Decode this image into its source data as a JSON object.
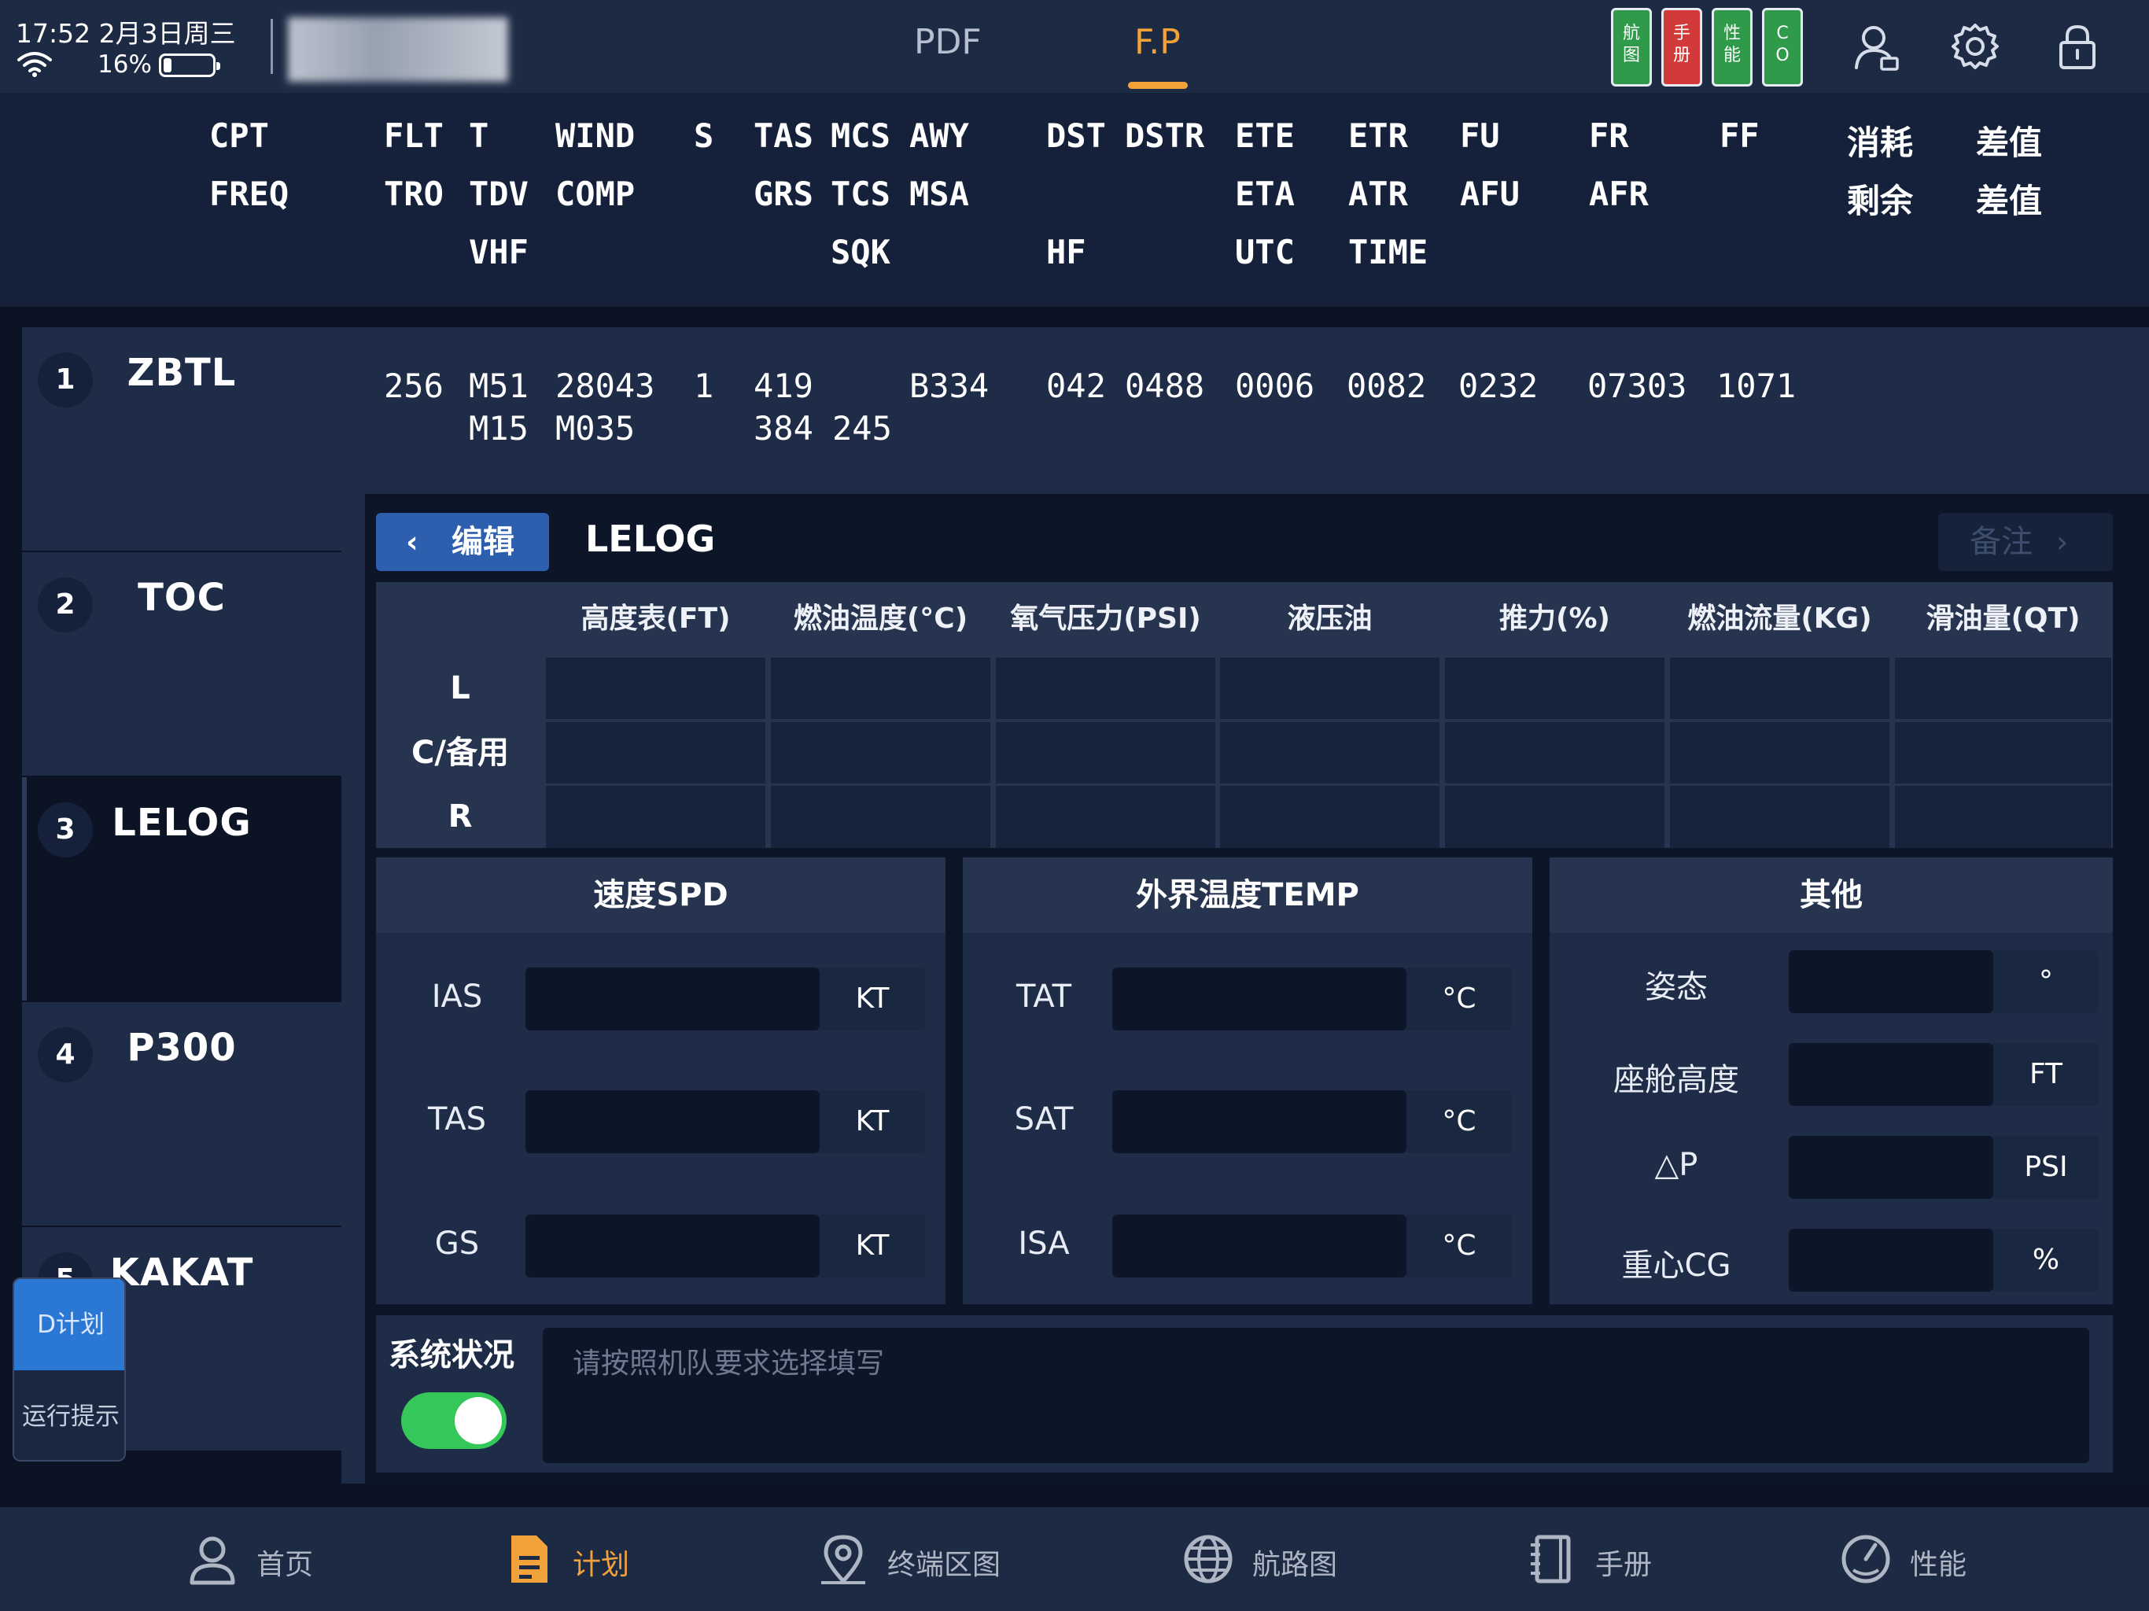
{
  "statusbar": {
    "time": "17:52 2月3日周三",
    "battery_pct": "16%",
    "battery_level": 0.16
  },
  "top_tabs": {
    "pdf": "PDF",
    "fp": "F.P",
    "active": "F.P"
  },
  "quick_access": [
    {
      "label": "航图",
      "color": "#2f9a4a"
    },
    {
      "label": "手册",
      "color": "#d23a3a"
    },
    {
      "label": "性能",
      "color": "#2f9a4a"
    },
    {
      "label": "CO",
      "color": "#2f9a4a"
    }
  ],
  "header_icons": [
    "user-icon",
    "gear-icon",
    "lock-icon"
  ],
  "columns": {
    "row1": [
      "CPT",
      "FLT",
      "T",
      "WIND",
      "S",
      "TAS",
      "MCS",
      "AWY",
      "DST",
      "DSTR",
      "ETE",
      "ETR",
      "FU",
      "FR",
      "FF",
      "消耗",
      "差值"
    ],
    "row2": [
      "FREQ",
      "TRO",
      "TDV",
      "COMP",
      "GRS",
      "TCS",
      "MSA",
      "ETA",
      "ATR",
      "AFU",
      "AFR",
      "剩余",
      "差值"
    ],
    "row3": [
      "VHF",
      "SQK",
      "HF",
      "UTC",
      "TIME"
    ]
  },
  "waypoints": [
    {
      "num": "1",
      "name": "ZBTL"
    },
    {
      "num": "2",
      "name": "TOC"
    },
    {
      "num": "3",
      "name": "LELOG"
    },
    {
      "num": "4",
      "name": "P300"
    },
    {
      "num": "5",
      "name": "KAKAT"
    }
  ],
  "selected_row": {
    "line1": [
      "256",
      "M51",
      "28043",
      "1",
      "419",
      "B334",
      "042",
      "0488",
      "0006",
      "0082",
      "0232",
      "07303",
      "1071"
    ],
    "line2": [
      "M15",
      "M035",
      "384",
      "245"
    ]
  },
  "form": {
    "edit_button": "编辑",
    "title": "LELOG",
    "note_button": "备注",
    "engine_table": {
      "headers": [
        "高度表(FT)",
        "燃油温度(°C)",
        "氧气压力(PSI)",
        "液压油",
        "推力(%)",
        "燃油流量(KG)",
        "滑油量(QT)"
      ],
      "rows": [
        "L",
        "C/备用",
        "R"
      ]
    },
    "speed": {
      "title": "速度SPD",
      "fields": [
        {
          "label": "IAS",
          "unit": "KT"
        },
        {
          "label": "TAS",
          "unit": "KT"
        },
        {
          "label": "GS",
          "unit": "KT"
        }
      ]
    },
    "temp": {
      "title": "外界温度TEMP",
      "fields": [
        {
          "label": "TAT",
          "unit": "°C"
        },
        {
          "label": "SAT",
          "unit": "°C"
        },
        {
          "label": "ISA",
          "unit": "°C"
        }
      ]
    },
    "other": {
      "title": "其他",
      "fields": [
        {
          "label": "姿态",
          "unit": "°"
        },
        {
          "label": "座舱高度",
          "unit": "FT"
        },
        {
          "label": "△P",
          "unit": "PSI"
        },
        {
          "label": "重心CG",
          "unit": "%"
        }
      ]
    },
    "system": {
      "label": "系统状况",
      "toggle_on": true,
      "placeholder": "请按照机队要求选择填写"
    }
  },
  "float_panel": {
    "d_plan": "D计划",
    "tips": "运行提示"
  },
  "bottom_nav": [
    {
      "label": "首页",
      "icon": "home-user-icon"
    },
    {
      "label": "计划",
      "icon": "plan-document-icon",
      "active": true
    },
    {
      "label": "终端区图",
      "icon": "map-pin-icon"
    },
    {
      "label": "航路图",
      "icon": "globe-icon"
    },
    {
      "label": "手册",
      "icon": "manual-book-icon"
    },
    {
      "label": "性能",
      "icon": "gauge-icon"
    }
  ],
  "colors": {
    "accent": "#f2a23a",
    "edit_blue": "#2d5fae",
    "toggle_green": "#35c759"
  }
}
